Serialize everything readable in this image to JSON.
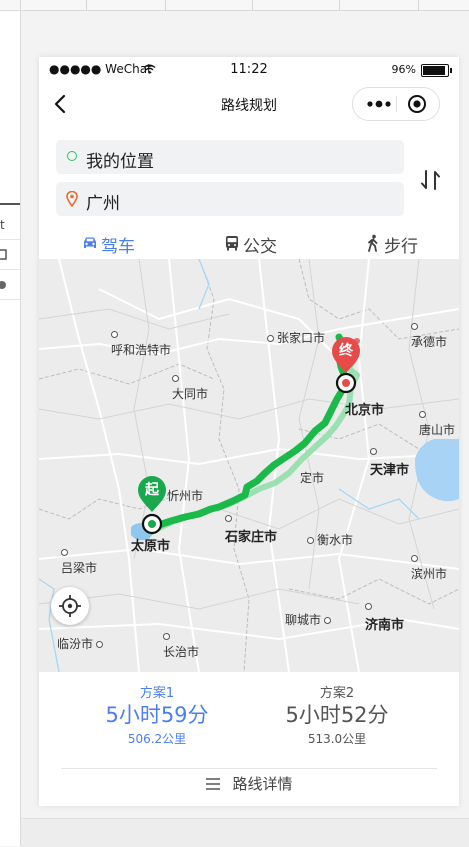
{
  "status_bar": {
    "carrier": "●●●●● WeChat",
    "time": "11:22",
    "battery": "96%"
  },
  "nav": {
    "title": "路线规划"
  },
  "route_form": {
    "from": "我的位置",
    "to": "广州"
  },
  "modes": [
    {
      "label": "驾车",
      "icon": "car-icon",
      "active": true
    },
    {
      "label": "公交",
      "icon": "bus-icon",
      "active": false
    },
    {
      "label": "步行",
      "icon": "walk-icon",
      "active": false
    }
  ],
  "map": {
    "cities": {
      "hohhot": "呼和浩特市",
      "zhangjiakou": "张家口市",
      "chengde": "承德市",
      "datong": "大同市",
      "beijing": "北京市",
      "tangshan": "唐山市",
      "tianjin": "天津市",
      "xinzhou": "忻州市",
      "shijiazhuang": "石家庄市",
      "taiyuan": "太原市",
      "hengshui": "衡水市",
      "binzhou": "滨州市",
      "lvliang": "吕梁市",
      "liaocheng": "聊城市",
      "jinan": "济南市",
      "linfen": "临汾市",
      "changzhi": "长治市",
      "baoding_partial": "定市"
    },
    "start_marker": "起",
    "end_marker": "终",
    "route_color": "#1bb94a",
    "alt_route_color": "#9be0b0",
    "start_color": "#1aa84f",
    "end_color": "#e84a4a"
  },
  "plans": [
    {
      "name": "方案1",
      "time": "5小时59分",
      "distance": "506.2公里",
      "selected": true
    },
    {
      "name": "方案2",
      "time": "5小时52分",
      "distance": "513.0公里",
      "selected": false
    }
  ],
  "details": {
    "label": "路线详情"
  },
  "left_panel": {
    "stub_1": "t"
  },
  "accent_color": "#4a7ff0"
}
